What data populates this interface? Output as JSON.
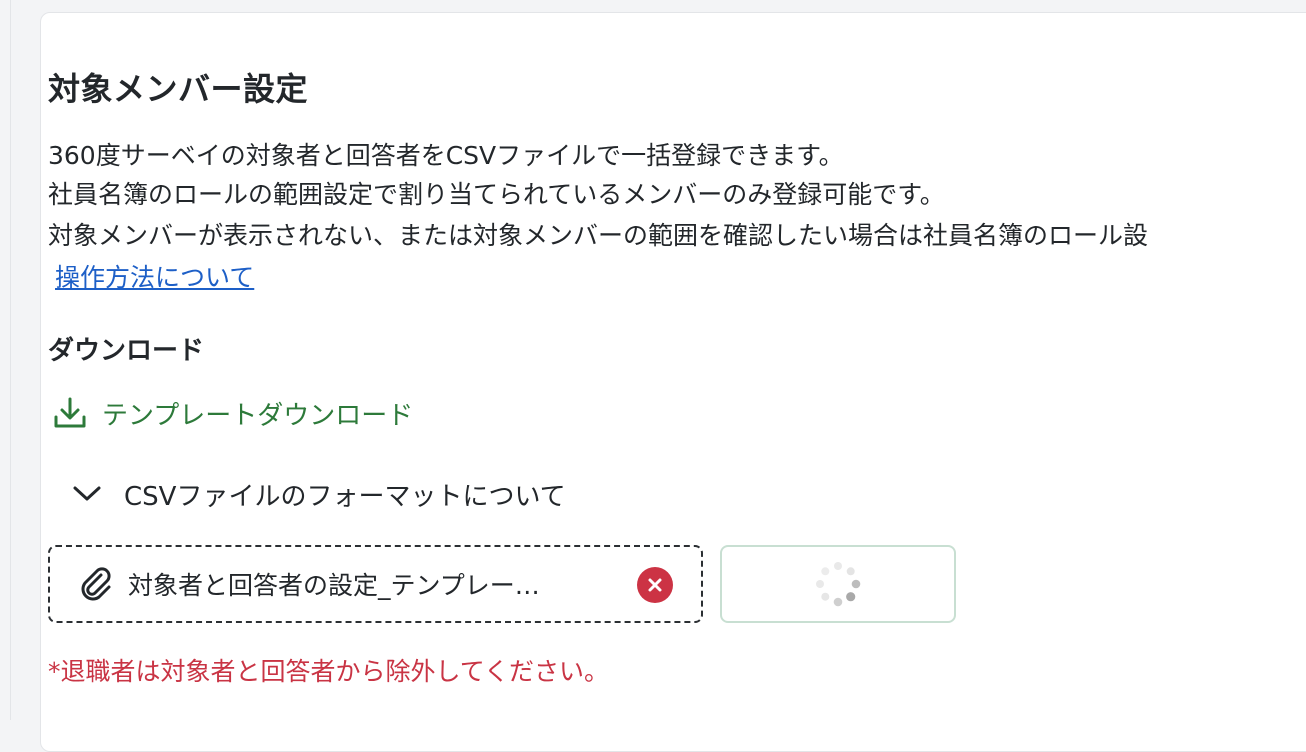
{
  "page": {
    "title": "対象メンバー設定",
    "description_lines": [
      "360度サーベイの対象者と回答者をCSVファイルで一括登録できます。",
      "社員名簿のロールの範囲設定で割り当てられているメンバーのみ登録可能です。",
      "対象メンバーが表示されない、または対象メンバーの範囲を確認したい場合は社員名簿のロール設"
    ],
    "help_link": "操作方法について"
  },
  "download": {
    "section_label": "ダウンロード",
    "template_link": "テンプレートダウンロード",
    "icon": "download-icon"
  },
  "format_accordion": {
    "label": "CSVファイルのフォーマットについて",
    "icon": "chevron-down-icon",
    "expanded": false
  },
  "upload": {
    "file_name": "対象者と回答者の設定_テンプレー…",
    "file_icon": "paperclip-icon",
    "remove_icon": "close-icon",
    "button_state": "loading",
    "button_icon": "spinner-icon"
  },
  "note": "*退職者は対象者と回答者から除外してください。",
  "colors": {
    "link": "#1d5fc7",
    "download_green": "#2d7a3a",
    "danger": "#cc3344",
    "note_red": "#c93444",
    "upload_border": "#c8dfd2"
  }
}
